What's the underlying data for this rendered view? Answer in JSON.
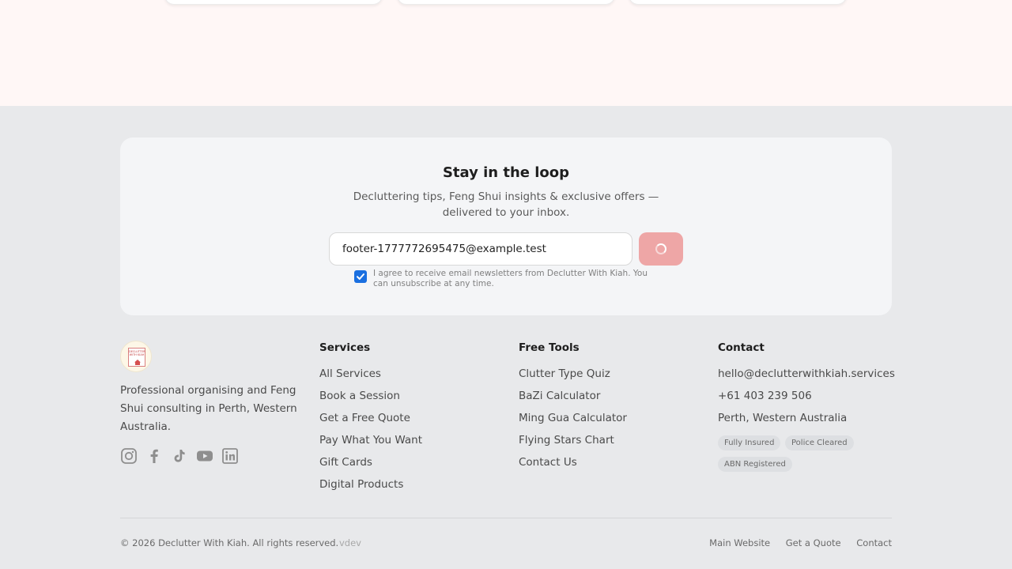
{
  "newsletter": {
    "title": "Stay in the loop",
    "subtitle": "Decluttering tips, Feng Shui insights & exclusive offers — delivered to your inbox.",
    "email_value": "footer-1777772695475@example.test",
    "submit_state": "loading",
    "consent_checked": true,
    "consent_text": "I agree to receive email newsletters from Declutter With Kiah. You can unsubscribe at any time."
  },
  "brand": {
    "logo_text": "DECLUTTER WITH KIAH",
    "about": "Professional organising and Feng Shui consulting in Perth, Western Australia.",
    "socials": [
      "instagram-icon",
      "facebook-icon",
      "tiktok-icon",
      "youtube-icon",
      "linkedin-icon"
    ]
  },
  "services": {
    "title": "Services",
    "items": [
      "All Services",
      "Book a Session",
      "Get a Free Quote",
      "Pay What You Want",
      "Gift Cards",
      "Digital Products"
    ]
  },
  "tools": {
    "title": "Free Tools",
    "items": [
      "Clutter Type Quiz",
      "BaZi Calculator",
      "Ming Gua Calculator",
      "Flying Stars Chart",
      "Contact Us"
    ]
  },
  "contact": {
    "title": "Contact",
    "email": "hello@declutterwithkiah.services",
    "phone": "+61 403 239 506",
    "location": "Perth, Western Australia",
    "badges": [
      "Fully Insured",
      "Police Cleared",
      "ABN Registered"
    ]
  },
  "footer": {
    "copyright": "© 2026 Declutter With Kiah. All rights reserved.",
    "version": "vdev",
    "links": [
      "Main Website",
      "Get a Quote",
      "Contact"
    ]
  },
  "colors": {
    "accent_button": "#eea6a6",
    "checkbox": "#1a6fe0",
    "top_band": "#fff7f6",
    "page_bg": "#e8e9eb"
  }
}
